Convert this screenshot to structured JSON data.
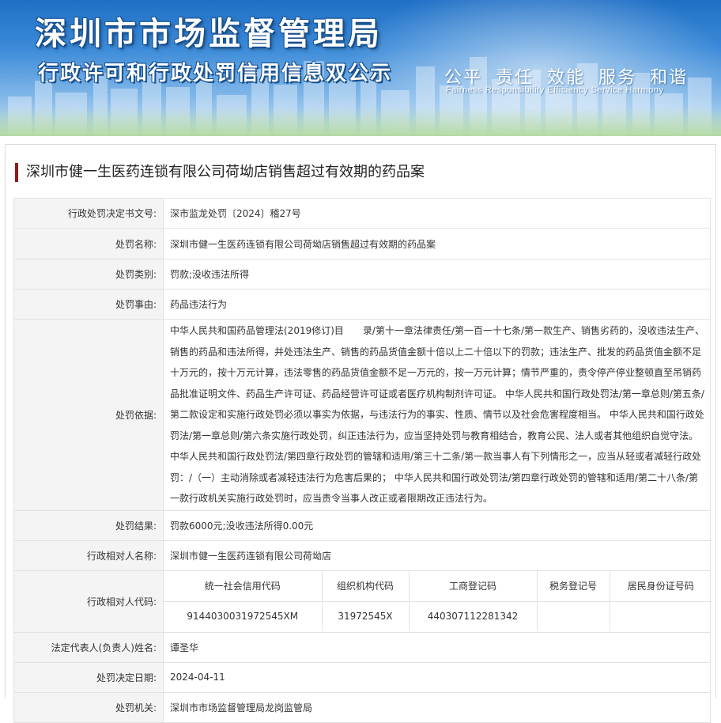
{
  "banner": {
    "title": "深圳市市场监督管理局",
    "subtitle": "行政许可和行政处罚信用信息双公示",
    "slogan_cn": "公平 责任 效能 服务 和谐",
    "slogan_en": "Fairness Responsibility Efficiency Service Harmony"
  },
  "case_title": "深圳市健一生医药连锁有限公司荷坳店销售超过有效期的药品案",
  "rows": {
    "decision_no": {
      "label": "行政处罚决定书文号:",
      "value": "深市监龙处罚〔2024〕稽27号"
    },
    "penalty_name": {
      "label": "处罚名称:",
      "value": "深圳市健一生医药连锁有限公司荷坳店销售超过有效期的药品案"
    },
    "penalty_type": {
      "label": "处罚类别:",
      "value": "罚款;没收违法所得"
    },
    "penalty_cause": {
      "label": "处罚事由:",
      "value": "药品违法行为"
    },
    "penalty_basis": {
      "label": "处罚依据:",
      "value": "中华人民共和国药品管理法(2019修订)目　　录/第十一章法律责任/第一百一十七条/第一款生产、销售劣药的，没收违法生产、销售的药品和违法所得，并处违法生产、销售的药品货值金额十倍以上二十倍以下的罚款；违法生产、批发的药品货值金额不足十万元的，按十万元计算，违法零售的药品货值金额不足一万元的，按一万元计算；情节严重的，责令停产停业整顿直至吊销药品批准证明文件、药品生产许可证、药品经营许可证或者医疗机构制剂许可证。 中华人民共和国行政处罚法/第一章总则/第五条/第二款设定和实施行政处罚必须以事实为依据，与违法行为的事实、性质、情节以及社会危害程度相当。 中华人民共和国行政处罚法/第一章总则/第六条实施行政处罚，纠正违法行为，应当坚持处罚与教育相结合，教育公民、法人或者其他组织自觉守法。 中华人民共和国行政处罚法/第四章行政处罚的管辖和适用/第三十二条/第一款当事人有下列情形之一，应当从轻或者减轻行政处罚：/（一）主动消除或者减轻违法行为危害后果的； 中华人民共和国行政处罚法/第四章行政处罚的管辖和适用/第二十八条/第一款行政机关实施行政处罚时，应当责令当事人改正或者限期改正违法行为。"
    },
    "penalty_result": {
      "label": "处罚结果:",
      "value": "罚款6000元;没收违法所得0.00元"
    },
    "party_name": {
      "label": "行政相对人名称:",
      "value": "深圳市健一生医药连锁有限公司荷坳店"
    },
    "party_code": {
      "label": "行政相对人代码:",
      "headers": [
        "统一社会信用代码",
        "组织机构代码",
        "工商登记码",
        "税务登记号",
        "居民身份证号码"
      ],
      "values": [
        "914403003197254​5XM",
        "31972545X",
        "440307112281342",
        "",
        ""
      ]
    },
    "legal_rep": {
      "label": "法定代表人(负责人)姓名:",
      "value": "谭圣华"
    },
    "decision_date": {
      "label": "处罚决定日期:",
      "value": "2024-04-11"
    },
    "authority": {
      "label": "处罚机关:",
      "value": "深圳市市场监督管理局龙岗监管局"
    }
  },
  "colors": {
    "accent_bar": "#8e1b1b",
    "label_bg": "#f4f4f4",
    "border": "#e2e2e2",
    "banner_blue": "#1f6fc6"
  }
}
